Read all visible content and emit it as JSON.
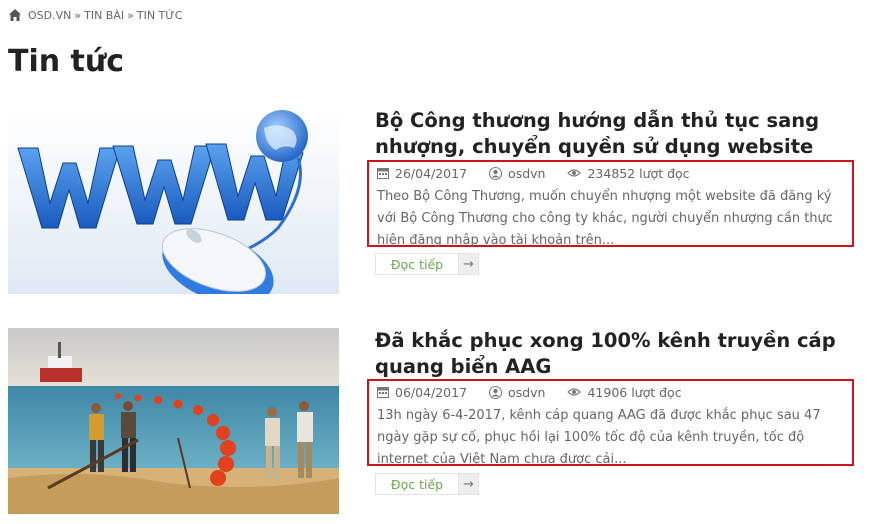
{
  "breadcrumb": {
    "home_icon": "home-icon",
    "items": [
      "OSD.VN",
      "TIN BÀI",
      "TIN TỨC"
    ],
    "separator": "»"
  },
  "page": {
    "title": "Tin tức"
  },
  "articles": [
    {
      "title": "Bộ Công thương hướng dẫn thủ tục sang nhượng, chuyển quyền sử dụng website",
      "date": "26/04/2017",
      "author": "osdvn",
      "views": "234852 lượt đọc",
      "excerpt": "Theo Bộ Công Thương, muốn chuyển nhượng một website đã đăng ký với Bộ Công Thương cho công ty khác, người chuyển nhượng cần thực hiện đăng nhập vào tài khoản trên...",
      "read_more": "Đọc tiếp",
      "read_more_arrow": "→",
      "thumbnail": "www-mouse-globe-image"
    },
    {
      "title": "Đã khắc phục xong 100% kênh truyền cáp quang biển AAG",
      "date": "06/04/2017",
      "author": "osdvn",
      "views": "41906 lượt đọc",
      "excerpt": "13h ngày 6-4-2017, kênh cáp quang AAG đã được khắc phục sau 47 ngày gặp sự cố, phục hồi lại 100% tốc độ của kênh truyền, tốc độ internet của Việt Nam chưa được cải...",
      "read_more": "Đọc tiếp",
      "read_more_arrow": "→",
      "thumbnail": "undersea-cable-beach-image"
    }
  ],
  "colors": {
    "highlight_border": "#d0121b",
    "read_more_text": "#6aa84f"
  }
}
